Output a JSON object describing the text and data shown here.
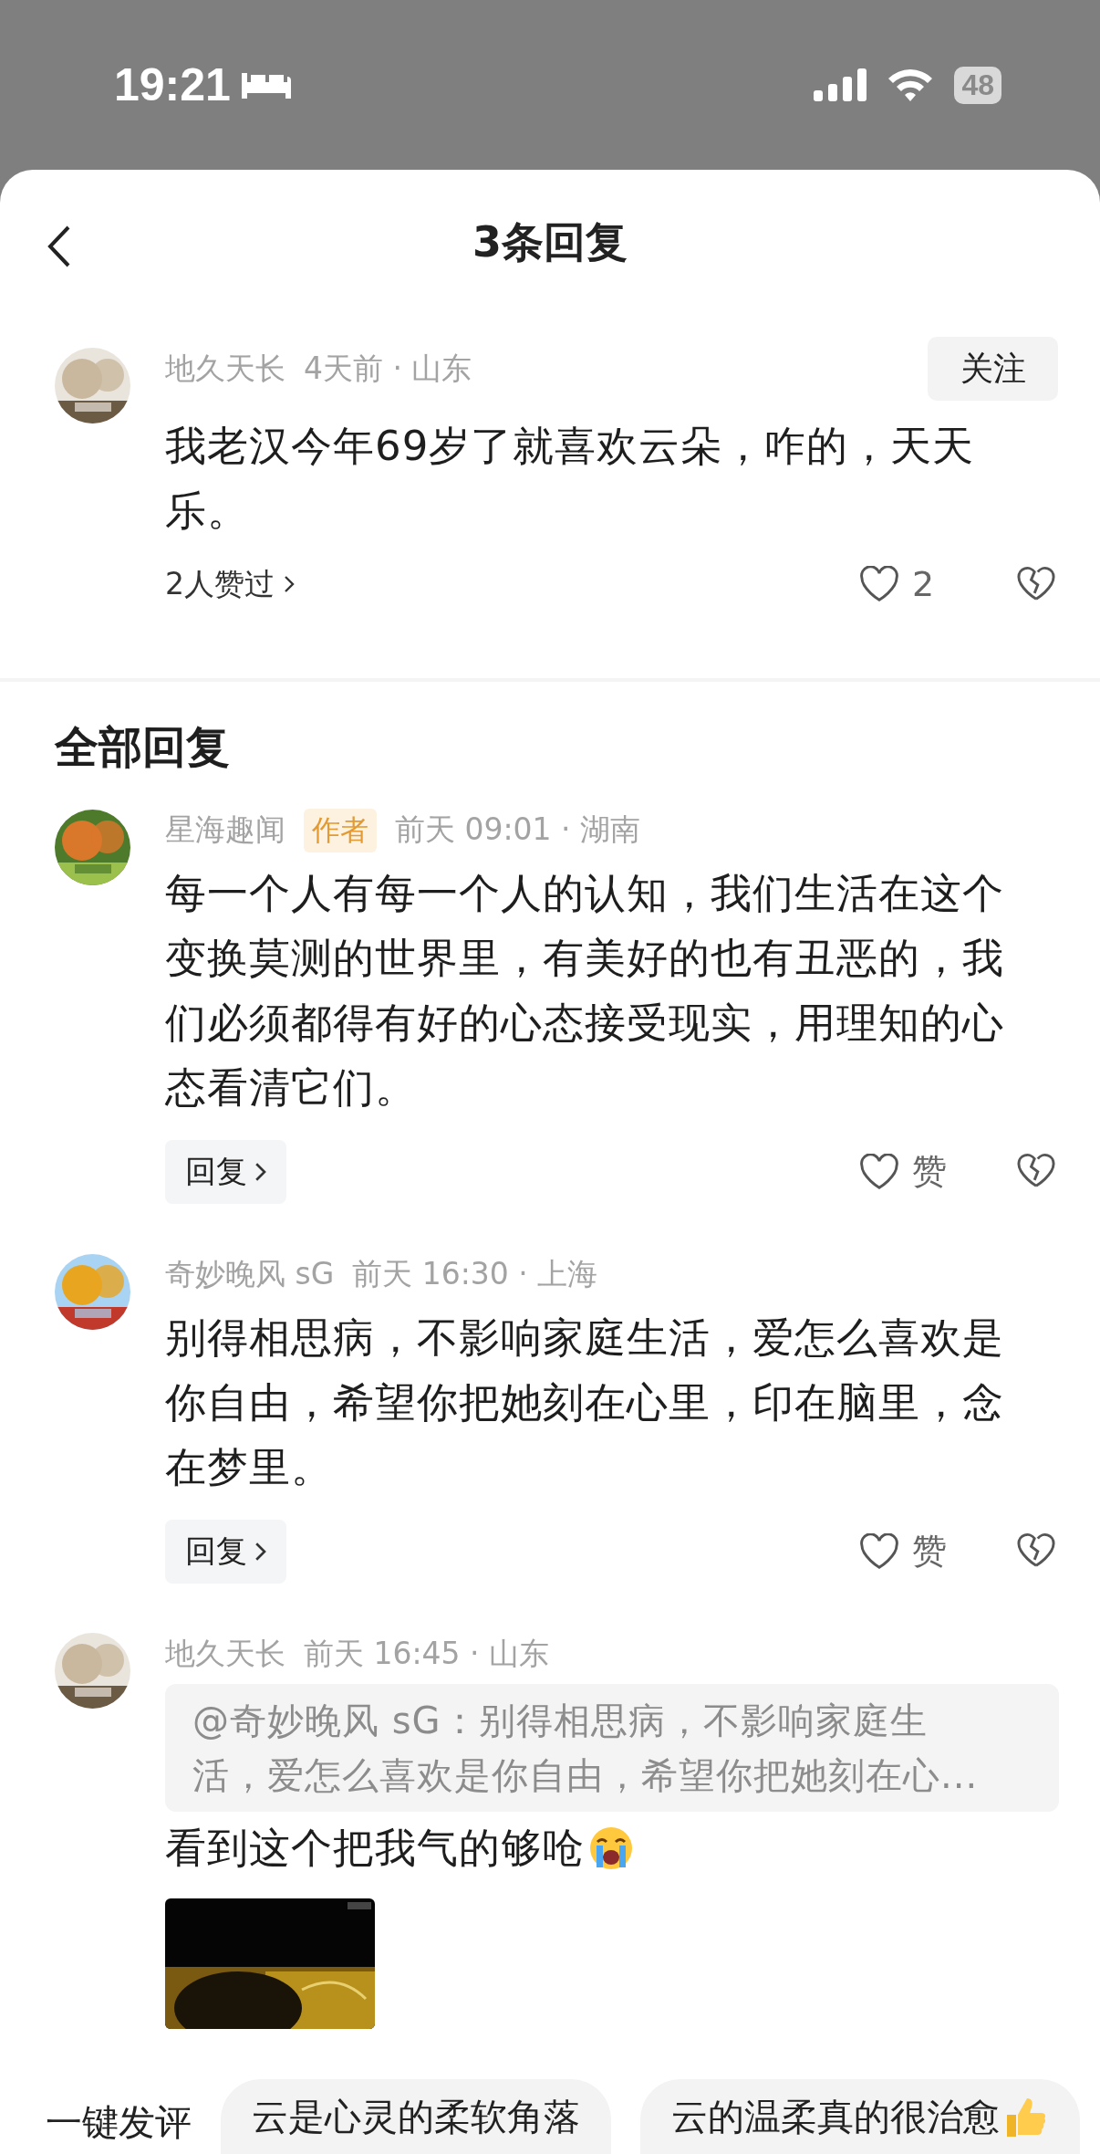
{
  "status_bar": {
    "time": "19:21",
    "battery": "48"
  },
  "header": {
    "title": "3条回复"
  },
  "root_comment": {
    "user": "地久天长",
    "meta": "4天前 · 山东",
    "follow": "关注",
    "text": "我老汉今年69岁了就喜欢云朵，咋的，天天乐。",
    "likers": "2人赞过",
    "likes": "2"
  },
  "section_title": "全部回复",
  "replies": [
    {
      "user": "星海趣闻",
      "badge": "作者",
      "meta": "前天 09:01 · 湖南",
      "text": "每一个人有每一个人的认知，我们生活在这个变换莫测的世界里，有美好的也有丑恶的，我们必须都得有好的心态接受现实，用理知的心态看清它们。",
      "reply_button": "回复",
      "like_label": "赞"
    },
    {
      "user": "奇妙晚风 sG",
      "meta": "前天 16:30 · 上海",
      "text": "别得相思病，不影响家庭生活，爱怎么喜欢是你自由，希望你把她刻在心里，印在脑里，念在梦里。",
      "reply_button": "回复",
      "like_label": "赞"
    },
    {
      "user": "地久天长",
      "meta": "前天 16:45 · 山东",
      "quote": "@奇妙晚风 sG：别得相思病，不影响家庭生活，爱怎么喜欢是你自由，希望你把她刻在心...",
      "text": "看到这个把我气的够呛"
    }
  ],
  "quick_comment": {
    "label": "一键发评",
    "chips": [
      "云是心灵的柔软角落",
      "云的温柔真的很治愈"
    ]
  }
}
